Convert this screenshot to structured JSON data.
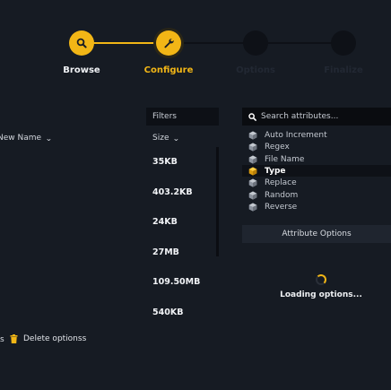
{
  "stepper": {
    "steps": [
      {
        "label": "Browse",
        "icon": "search-icon",
        "state": "done"
      },
      {
        "label": "Configure",
        "icon": "wrench-icon",
        "state": "current"
      },
      {
        "label": "Options",
        "icon": "",
        "state": "pending"
      },
      {
        "label": "Finalize",
        "icon": "",
        "state": "pending"
      }
    ]
  },
  "files": {
    "filters_label": "Filters",
    "name_column": "New Name",
    "size_column": "Size",
    "sizes": [
      "35KB",
      "403.2KB",
      "24KB",
      "27MB",
      "109.50MB",
      "540KB"
    ],
    "left_fragment": "s",
    "delete_label": "Delete optionss"
  },
  "attributes": {
    "search_placeholder": "Search attributes...",
    "items": [
      {
        "label": "Auto Increment",
        "selected": false
      },
      {
        "label": "Regex",
        "selected": false
      },
      {
        "label": "File Name",
        "selected": false
      },
      {
        "label": "Type",
        "selected": true
      },
      {
        "label": "Replace",
        "selected": false
      },
      {
        "label": "Random",
        "selected": false
      },
      {
        "label": "Reverse",
        "selected": false
      }
    ],
    "options_header": "Attribute Options",
    "loading_text": "Loading options..."
  },
  "colors": {
    "accent": "#f2b616",
    "background": "#161b23",
    "panel_dark": "#0d1016"
  }
}
